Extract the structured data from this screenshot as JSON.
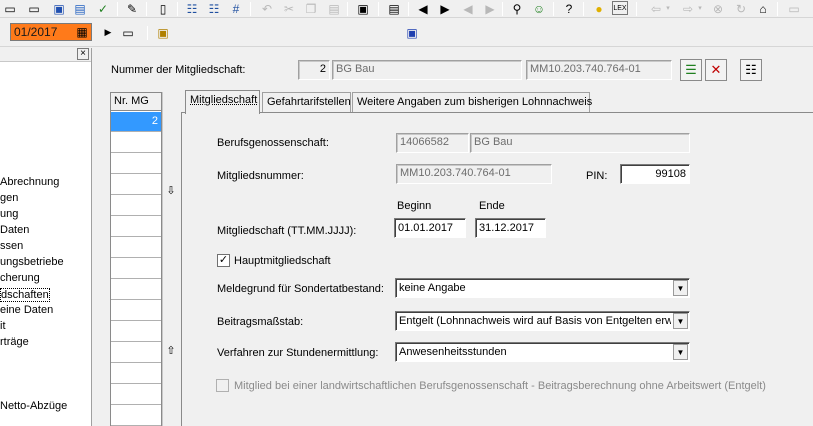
{
  "toolbar": {
    "icons": [
      "tb-icon-1",
      "tb-icon-2",
      "tb-icon-3",
      "tb-icon-4",
      "tb-icon-5",
      "tb-icon-6",
      "tb-icon-7",
      "tb-icon-8",
      "tb-icon-9",
      "undo",
      "cut",
      "copy",
      "paste",
      "tb-icon-14",
      "tb-icon-15",
      "arrow-left",
      "arrow-right",
      "arrow-left-disabled",
      "arrow-right-disabled",
      "binoculars",
      "tb-icon-21",
      "help-pointer",
      "lightbulb",
      "lex",
      "back",
      "forward",
      "stop",
      "refresh",
      "home",
      "print"
    ],
    "lex_label": "LEX"
  },
  "period": {
    "value": "01/2017"
  },
  "left_nav": {
    "items": [
      "Abrechnung",
      "gen",
      "ung",
      "Daten",
      "ssen",
      "ungsbetriebe",
      "cherung",
      "dschaften",
      "eine Daten",
      "it",
      "rträge",
      "Netto-Abzüge"
    ],
    "active_index": 7
  },
  "header": {
    "membership_label": "Nummer der Mitgliedschaft:",
    "membership_number": "2",
    "insurer_name": "BG Bau",
    "member_id": "MM10.203.740.764-01"
  },
  "mg_list": {
    "header": "Nr. MG",
    "rows": [
      "2"
    ]
  },
  "tabs": [
    {
      "label": "Mitgliedschaft",
      "underline": "M"
    },
    {
      "label": "Gefahrtarifstellen",
      "underline": "G"
    },
    {
      "label": "Weitere Angaben zum bisherigen Lohnnachweis",
      "underline": "W"
    }
  ],
  "form": {
    "bg_label": "Berufsgenossenschaft:",
    "bg_number": "14066582",
    "bg_name": "BG Bau",
    "member_no_label": "Mitgliedsnummer:",
    "member_no_value": "MM10.203.740.764-01",
    "pin_label": "PIN:",
    "pin_value": "99108",
    "begin_label": "Beginn",
    "end_label": "Ende",
    "period_label": "Mitgliedschaft (TT.MM.JJJJ):",
    "begin_value": "01.01.2017",
    "end_value": "31.12.2017",
    "main_membership_label": "Hauptmitgliedschaft",
    "main_membership_checked": true,
    "reason_label": "Meldegrund für Sondertatbestand:",
    "reason_value": "keine Angabe",
    "scale_label": "Beitragsmaßstab:",
    "scale_value": "Entgelt (Lohnnachweis wird auf Basis von Entgelten erwa",
    "hours_label": "Verfahren zur Stundenermittlung:",
    "hours_value": "Anwesenheitsstunden",
    "agri_label": "Mitglied bei einer landwirtschaftlichen Berufsgenossenschaft - Beitragsberechnung ohne Arbeitswert (Entgelt)",
    "agri_checked": false
  },
  "colors": {
    "period_bg": "#ff7a1a",
    "selection": "#3399ff"
  }
}
